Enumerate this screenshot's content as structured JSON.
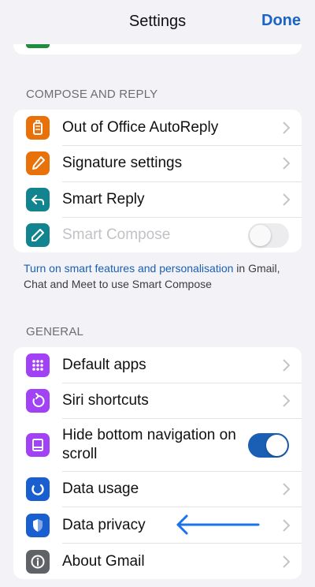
{
  "nav": {
    "title": "Settings",
    "done_label": "Done"
  },
  "sections": {
    "compose": {
      "header": "COMPOSE AND REPLY",
      "items": [
        {
          "label": "Out of Office AutoReply",
          "icon": "suitcase-icon",
          "color": "#e8710a"
        },
        {
          "label": "Signature settings",
          "icon": "pen-icon",
          "color": "#e8710a"
        },
        {
          "label": "Smart Reply",
          "icon": "reply-icon",
          "color": "#12848f"
        },
        {
          "label": "Smart Compose",
          "icon": "pencil-icon",
          "color": "#12848f",
          "disabled": true,
          "toggle": "off"
        }
      ],
      "footnote": {
        "link": "Turn on smart features and personalisation",
        "rest": " in Gmail, Chat and Meet to use Smart Compose"
      }
    },
    "general": {
      "header": "GENERAL",
      "items": [
        {
          "label": "Default apps",
          "icon": "grid-icon",
          "color": "#a142f4"
        },
        {
          "label": "Siri shortcuts",
          "icon": "refresh-icon",
          "color": "#a142f4"
        },
        {
          "label": "Hide bottom navigation on scroll",
          "icon": "window-icon",
          "color": "#a142f4",
          "toggle": "on"
        },
        {
          "label": "Data usage",
          "icon": "donut-icon",
          "color": "#1a5fd0"
        },
        {
          "label": "Data privacy",
          "icon": "shield-icon",
          "color": "#1a5fd0"
        },
        {
          "label": "About Gmail",
          "icon": "info-icon",
          "color": "#5f6368"
        }
      ]
    }
  },
  "colors": {
    "accent": "#1a5fb4",
    "background": "#f2f2f7",
    "annotation_arrow": "#1a73e8"
  }
}
